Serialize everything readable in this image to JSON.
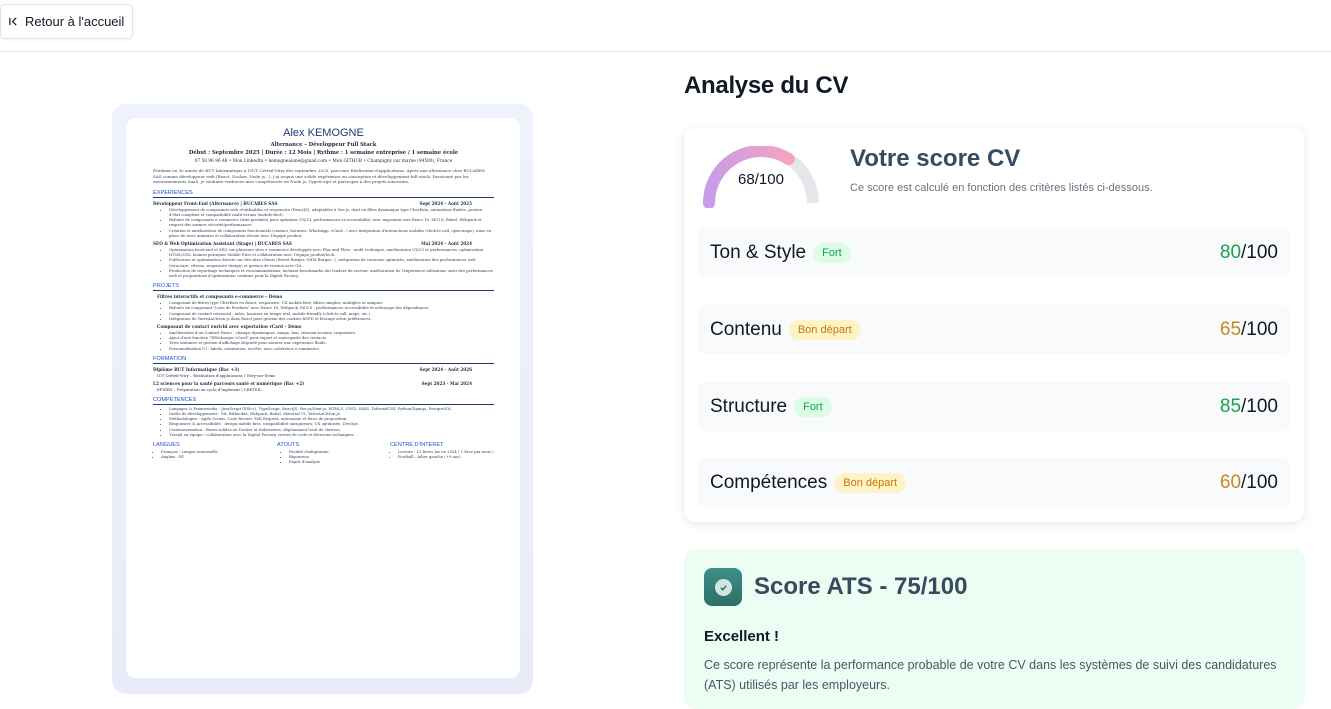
{
  "topbar": {
    "back_label": "Retour à l'accueil",
    "back_icon": "arrow-to-left-icon"
  },
  "cv": {
    "name": "Alex KEMOGNE",
    "subtitle": "Alternance – Développeur Full Stack",
    "info": "Début : Septembre 2025 | Durée : 12 Mois | Rythme : 1 semaine entreprise / 1 semaine école",
    "contact": "07 58 96 96 48 • Mon LinkedIn • kemognealone@gmail.com • Mon GITHUB • Champigny sur marne (94500), France",
    "summary": "Étudiant en 3e année de BUT Informatique à l'IUT Créteil-Vitry dès septembre 2025, parcours Réalisation d'applications. Après une alternance chez BUCARES SAS comme développeur web (React, Docker, Node.js...), j'ai acquis une solide expérience en conception et développement full-stack. Passionné par les environnements SaaS, je souhaite renforcer mes compétences en Node.js, TypeScript et participer à des projets innovants.",
    "sections": {
      "experiences": "EXPERIENCES",
      "projets": "PROJETS",
      "formation": "FORMATION",
      "competences": "COMPETENCES"
    },
    "jobs": [
      {
        "title": "Développeur Front-End (Alternance) | BUCARES SAS",
        "dates": "Sept 2024 - Août 2025",
        "bullets": [
          "Développement de composants web réutilisables et responsive (ReactJS), adaptables à Vue.js, dont un filtre dynamique type UberEats, animations fluides, gestion d'état complexe et compatibilité multi-écrans (mobile-first).",
          "Refonte de composants e-commerce (liste produits) pour optimiser UX/UI, performances et accessibilité, avec migration vers React 18, MUI 6, Babel, Webpack et respect des normes sécurité/performances.",
          "Création et amélioration de composants fonctionnels (contact, horaires, WhatsApp, vCard...) avec intégration d'interactions mobiles (click-to-call, open-maps), mise en place de tests unitaires et collaboration étroite avec l'équipe produit."
        ]
      },
      {
        "title": "SEO & Web Optimization Assistant (Stage) | BUCARES SAS",
        "dates": "Mai 2024 - Août 2024",
        "bullets": [
          "Optimisation front-end et SEO sur plusieurs sites e-commerce développés avec Plur and Plote : audit technique, amélioration UX/UI et performances, optimisation HTML/CSS, bonnes pratiques Mobile First et collaboration avec l'équipe produit/tech.",
          "Publication et optimisation directe sur des sites clients (Sweet Burger, GHM Burger...), intégration de contenus optimisés, amélioration des performances web (structure, vitesse, responsive design) et gestion de version avec Git.",
          "Production de reportings techniques et recommandations, incluant benchmarks des leaders du secteur, amélioration de l'expérience utilisateur, suivi des performances web et propositions d'optimisation continue pour la Digital Factory."
        ]
      }
    ],
    "projects": [
      {
        "title": "Filtres interactifs et composants e-commerce – Démo",
        "bullets": [
          "Composant de filtres type UberEats en React, responsive, UX mobile-first, filtres simples, multiples et uniques.",
          "Refonte du composant \"Liste de Produits\" avec React 18, Webpack, MUI 6 : performances, accessibilité et nettoyage des dépendances.",
          "Composant de contact interactif : infos, horaires en temps réel, mobile-friendly (click-to-call, maps, etc.).",
          "Intégration de TarteAuCitron.js dans React pour gestion des cookies RGPD et blocage selon préférences."
        ]
      },
      {
        "title": "Composant de contact enrichi avec exportation vCard – Démo",
        "bullets": [
          "Amélioration d'un Contact React : champs dynamiques, image, lien, réseaux sociaux, responsive.",
          "Ajout d'une fonction \"Télécharger vCard\" pour export et sauvegarde des contacts.",
          "Tests unitaires et gestion d'affichage dégradé pour assurer une expérience fluide.",
          "Personnalisation UI : labels, orientation, en-tête, avec cohérence e-commerce."
        ]
      }
    ],
    "formation": [
      {
        "title": "Diplôme BUT Informatique (Bac +3)",
        "dates": "Sept 2024 - Août 2026",
        "detail": "IUT Créteil-Vitry – Réalisation d'applications | Vitry-sur-Seine"
      },
      {
        "title": "L2 sciences pour la santé parcours santé et numérique (Bac +2)",
        "dates": "Sept 2023 - Mai 2024",
        "detail": "EPISEN – Préparation au cycle d'Ingénieur | CRETEIL"
      }
    ],
    "competences": [
      "Langages & Frameworks : JavaScript (ES6+), TypeScript, ReactJS, Vue.js/Nuxt.js, HTML5, CSS3, SASS, TailwindCSS, Python/Django, PostgreSQL",
      "Outils de développement : Git, Bitbucket, Webpack, Babel, Material UI, TarteAuCitron.js.",
      "Méthodologies : Agile Scrum, Code Review, Pull Request, autonomie et force de proposition.",
      "Responsive & Accessibilité : design mobile first, compatibilité navigateurs, UX optimisée, DevOps.",
      "Conteneurisation : Bases solides en Docker et Kubernetes, déploiement local de clusters.",
      "Travail en équipe : collaboration avec la Digital Factory, revues de code et décisions techniques."
    ],
    "bottom": {
      "langues": {
        "title": "LANGUES",
        "items": [
          "Français : Langue maternelle",
          "Anglais : B1"
        ]
      },
      "atouts": {
        "title": "ATOUTS",
        "items": [
          "Facilité d'adaptation",
          "Rigoureux",
          "Esprit d'analyse"
        ]
      },
      "interet": {
        "title": "CENTRE D'INTERET",
        "items": [
          "Lecture : 12 livres lus en 2024 ( 1 livre par mois )",
          "Football : Ailier gauche (+9 ans)"
        ]
      }
    }
  },
  "analysis": {
    "title": "Analyse du CV",
    "score": {
      "value": 68,
      "max": 100,
      "label": "68/100",
      "fraction": 0.68,
      "title": "Votre score CV",
      "description": "Ce score est calculé en fonction des critères listés ci-dessous."
    },
    "categories": [
      {
        "name": "Ton & Style",
        "badge": "Fort",
        "tone": "green",
        "score": "80",
        "max": "/100"
      },
      {
        "name": "Contenu",
        "badge": "Bon départ",
        "tone": "amber",
        "score": "65",
        "max": "/100"
      },
      {
        "name": "Structure",
        "badge": "Fort",
        "tone": "green",
        "score": "85",
        "max": "/100"
      },
      {
        "name": "Compétences",
        "badge": "Bon départ",
        "tone": "amber",
        "score": "60",
        "max": "/100"
      }
    ],
    "ats": {
      "title": "Score ATS - 75/100",
      "verdict": "Excellent !",
      "text": "Ce score représente la performance probable de votre CV dans les systèmes de suivi des candidatures (ATS) utilisés par les employeurs.",
      "icon": "check-badge-icon"
    }
  },
  "colors": {
    "green": "#16a34a",
    "amber": "#c58a1a",
    "gauge_start": "#c99ce8",
    "gauge_end": "#f5a3c0",
    "gauge_track": "#e5e7eb"
  }
}
